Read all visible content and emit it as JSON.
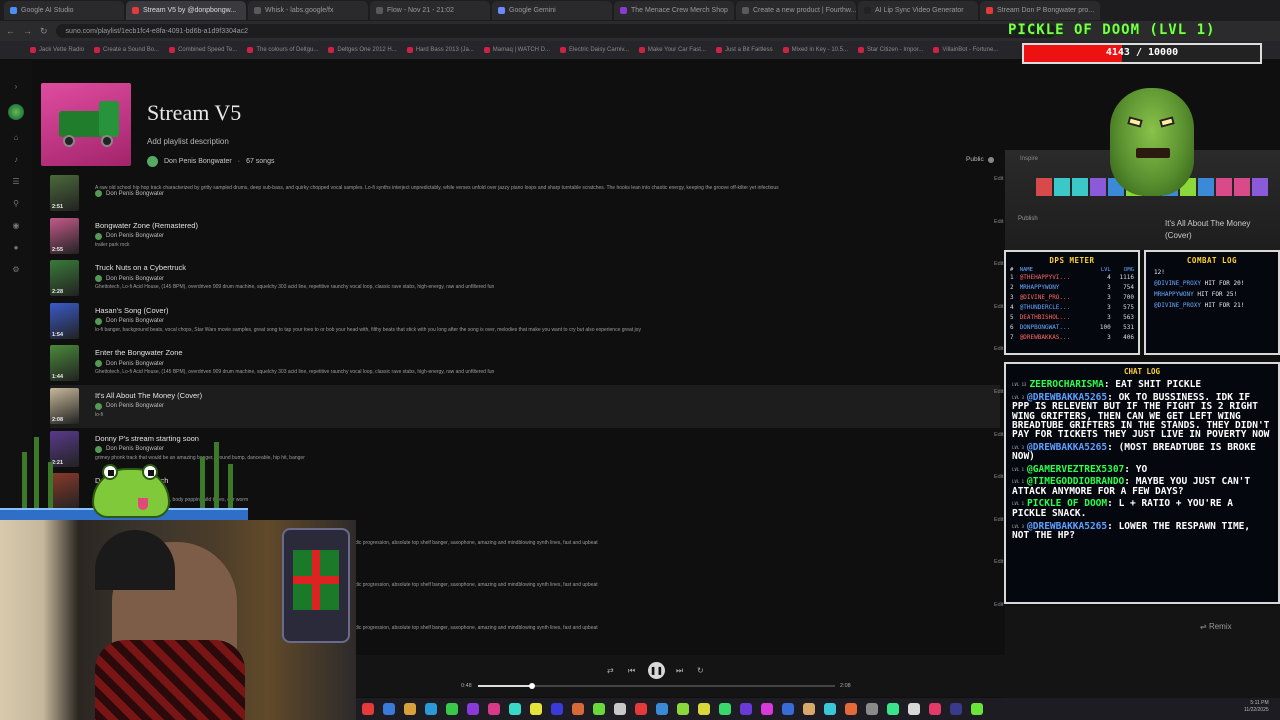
{
  "browser": {
    "tabs": [
      {
        "label": "Google AI Studio",
        "color": "#4a8ff7",
        "active": false
      },
      {
        "label": "Stream V5 by @donpbongw...",
        "color": "#e43a3a",
        "active": true
      },
      {
        "label": "Whisk - labs.google/fx",
        "color": "#5a5a5a",
        "active": false
      },
      {
        "label": "Flow - Nov 21 - 21:02",
        "color": "#5a5a5a",
        "active": false
      },
      {
        "label": "Google Gemini",
        "color": "#6a8aff",
        "active": false
      },
      {
        "label": "The Menace Crew Merch Shop",
        "color": "#8a3ad0",
        "active": false
      },
      {
        "label": "Create a new product | Fourthw...",
        "color": "#5a5a5a",
        "active": false
      },
      {
        "label": "AI Lip Sync Video Generator",
        "color": "#222",
        "active": false
      },
      {
        "label": "Stream Don P Bongwater pro...",
        "color": "#e43a3a",
        "active": false
      }
    ],
    "url": "suno.com/playlist/1ecb1fc4-e8fa-4091-bd6b-a1d9f3304ac2",
    "bookmarks": [
      "Jack Vette Radio",
      "Create a Sound Bo...",
      "Combined Speed Te...",
      "The colours of Deltgu...",
      "Deltges One 2012 H...",
      "Hard Bass 2013 (Ja...",
      "Mamaq | WATCH D...",
      "Electric Daisy Carniv...",
      "Make Your Car Fast...",
      "Just a Bit Fartless",
      "Mixed in Key - 10.5...",
      "Star Citizen - Impor...",
      "VillainBot - Fortune..."
    ]
  },
  "playlist": {
    "title": "Stream V5",
    "description": "Add playlist description",
    "owner": "Don Penis Bongwater",
    "song_count": "67 songs",
    "visibility": "Public"
  },
  "tracks": [
    {
      "title": "",
      "artist": "Don Penis Bongwater",
      "style": "A raw old school hip hop track characterized by gritty sampled drums, deep sub-bass, and quirky chopped vocal samples. Lo-fi synths interject unpredictably, while verses unfold over jazzy piano loops and sharp turntable scratches. The hooks lean into chaotic energy, keeping the groove off-kilter yet infectious",
      "duration": "2:51",
      "thumb": "#4a6a3a"
    },
    {
      "title": "Bongwater Zone (Remastered)",
      "artist": "Don Penis Bongwater",
      "style": "trailer park rock",
      "duration": "2:55",
      "thumb": "#c45a8a"
    },
    {
      "title": "Truck Nuts on a Cybertruck",
      "artist": "Don Penis Bongwater",
      "style": "Ghettotech, Lo-fi Acid House, (145 BPM), overdriven 909 drum machine, squelchy 303 acid line, repetitive raunchy vocal loop, classic rave stabs, high-energy, raw and unfiltered fun",
      "duration": "2:28",
      "thumb": "#3a7a3a"
    },
    {
      "title": "Hasan's Song (Cover)",
      "artist": "Don Penis Bongwater",
      "style": "lo-fi banger, background beats, vocal chops, Star Wars movie samples, great song to tap your toes to or bob your head with, filthy beats that stick with you long after the song is over, melodies that make you want to cry but also experience great joy",
      "duration": "1:54",
      "thumb": "#3a5ac8"
    },
    {
      "title": "Enter the Bongwater Zone",
      "artist": "Don Penis Bongwater",
      "style": "Ghettotech, Lo-fi Acid House, (145 BPM), overdriven 909 drum machine, squelchy 303 acid line, repetitive raunchy vocal loop, classic rave stabs, high-energy, raw and unfiltered fun",
      "duration": "1:44",
      "thumb": "#4a8a3a"
    },
    {
      "title": "It's All About The Money (Cover)",
      "artist": "Don Penis Bongwater",
      "style": "lo-fi",
      "duration": "2:08",
      "thumb": "#c8b89a"
    },
    {
      "title": "Donny P's stream starting soon",
      "artist": "Don Penis Bongwater",
      "style": "grimey phonk track that would be an amazing banger, ground bump, danceable, hip hit, banger",
      "duration": "2:21",
      "thumb": "#5a3a8a"
    },
    {
      "title": "Dance with the Roach",
      "artist": "",
      "style": "groove, makes you want to dance, body poppin, wild times, ear worm",
      "duration": "",
      "thumb": "#8a3a2a"
    },
    {
      "title": "",
      "artist": "",
      "style": "dic progression, absolute top shelf banger, saxophone, amazing and mindblowing synth lines, fast and upbeat",
      "duration": "",
      "thumb": "#222"
    },
    {
      "title": "",
      "artist": "",
      "style": "dic progression, absolute top shelf banger, saxophone, amazing and mindblowing synth lines, fast and upbeat",
      "duration": "",
      "thumb": "#222"
    },
    {
      "title": "",
      "artist": "",
      "style": "dic progression, absolute top shelf banger, saxophone, amazing and mindblowing synth lines, fast and upbeat",
      "duration": "",
      "thumb": "#222"
    }
  ],
  "edit_label": "Edit",
  "player": {
    "time_current": "0:48",
    "time_total": "2:08",
    "progress": 0.15
  },
  "overlay": {
    "boss_name": "PICKLE OF DOOM (LVL 1)",
    "hp_text": "4143 / 10000",
    "hp_fraction": 0.4143,
    "inspire_label": "Inspire",
    "publish_label": "Publish",
    "side_title": "It's All About The Money (Cover)",
    "remix_label": "Remix",
    "dps": {
      "title": "DPS METER",
      "headers": [
        "#",
        "NAME",
        "LVL",
        "DMG"
      ],
      "rows": [
        {
          "rank": "1",
          "name": "@THEHAPPYVI...",
          "lvl": "4",
          "dmg": "1116"
        },
        {
          "rank": "2",
          "name": "MRHAPPYWONY",
          "lvl": "3",
          "dmg": "754"
        },
        {
          "rank": "3",
          "name": "@DIVINE_PRO...",
          "lvl": "3",
          "dmg": "700"
        },
        {
          "rank": "4",
          "name": "@THUNDERCLE...",
          "lvl": "3",
          "dmg": "575"
        },
        {
          "rank": "5",
          "name": "DEATHBISHOL...",
          "lvl": "3",
          "dmg": "563"
        },
        {
          "rank": "6",
          "name": "DONPBONGWAT...",
          "lvl": "100",
          "dmg": "531"
        },
        {
          "rank": "7",
          "name": "@DREWBAKKAS...",
          "lvl": "3",
          "dmg": "406"
        }
      ]
    },
    "combat": {
      "title": "COMBAT LOG",
      "lines": [
        {
          "name": "",
          "text": "12!"
        },
        {
          "name": "@DIVINE_PROXY",
          "text": " HIT FOR 20!"
        },
        {
          "name": "MRHAPPYWONY",
          "text": " HIT FOR 25!"
        },
        {
          "name": "@DIVINE_PROXY",
          "text": " HIT FOR 21!"
        }
      ]
    },
    "chat": {
      "title": "CHAT LOG",
      "messages": [
        {
          "lvl": "LVL 13",
          "user": "ZEEROCHARISMA",
          "color": "green",
          "text": ": EAT SHIT PICKLE"
        },
        {
          "lvl": "LVL 3",
          "user": "@DREWBAKKA5265",
          "color": "blue",
          "text": ": OK TO BUSSINESS. IDK IF PPP IS RELEVENT BUT IF THE FIGHT IS 2 RIGHT WING GRIFTERS, THEN CAN WE GET LEFT WING BREADTUBE GRIFTERS IN THE STANDS. THEY DIDN'T PAY FOR TICKETS THEY JUST LIVE IN POVERTY NOW"
        },
        {
          "lvl": "LVL 3",
          "user": "@DREWBAKKA5265",
          "color": "blue",
          "text": ": (MOST BREADTUBE IS BROKE NOW)"
        },
        {
          "lvl": "LVL 1",
          "user": "@GAMERVEZTREX5307",
          "color": "green",
          "text": ": YO"
        },
        {
          "lvl": "LVL 1",
          "user": "@TIMEGODDIOBRANDO",
          "color": "green",
          "text": ": MAYBE YOU JUST CAN'T ATTACK ANYMORE FOR A FEW DAYS?"
        },
        {
          "lvl": "LVL 1",
          "user": "PICKLE OF DOOM",
          "color": "green",
          "text": ": L + RATIO + YOU'RE A PICKLE SNACK."
        },
        {
          "lvl": "LVL 3",
          "user": "@DREWBAKKA5265",
          "color": "blue",
          "text": ": LOWER THE RESPAWN TIME, NOT THE HP?"
        }
      ]
    }
  },
  "clock": {
    "time": "5:11 PM",
    "date": "11/22/2025"
  },
  "colors": {
    "hp_red": "#e11111",
    "boss_green": "#7bff4a",
    "panel_gold": "#ffd22a",
    "chat_green": "#2bff4a",
    "chat_blue": "#5aa0ff"
  }
}
